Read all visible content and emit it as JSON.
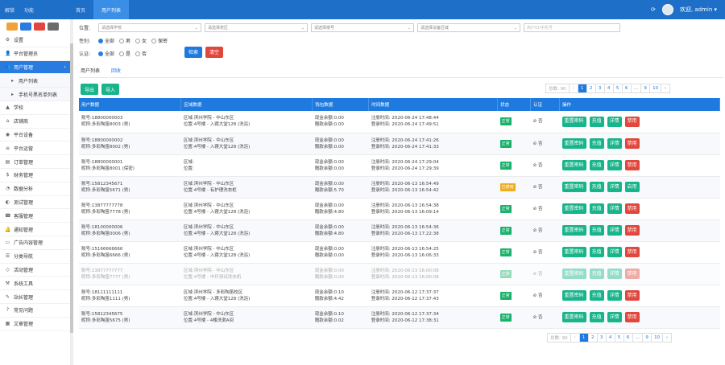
{
  "topbar": {
    "brand": [
      "解锁",
      "功能"
    ],
    "tabs": [
      "首页",
      "用户列表"
    ],
    "active_tab": 1,
    "user": "欢迎, admin ▾",
    "refresh_icon": "refresh-icon",
    "avatar_label": "admin"
  },
  "sidebar": {
    "buttons": [
      "#f0a33a",
      "#2a7be0",
      "#e2473d",
      "#6b6b6b"
    ],
    "items": [
      {
        "label": "设置",
        "icon": "⚙",
        "state": ""
      },
      {
        "label": "平台管理员",
        "icon": "👤",
        "state": ""
      },
      {
        "label": "用户管理",
        "icon": "👥",
        "state": "active"
      },
      {
        "label": "用户列表",
        "icon": "▸",
        "state": "sub"
      },
      {
        "label": "手机号黑名单列表",
        "icon": "▸",
        "state": "sub"
      },
      {
        "label": "学校",
        "icon": "▲",
        "state": ""
      },
      {
        "label": "店铺商",
        "icon": "⌂",
        "state": ""
      },
      {
        "label": "平台设备",
        "icon": "◉",
        "state": ""
      },
      {
        "label": "平台运营",
        "icon": "≡",
        "state": ""
      },
      {
        "label": "订单管理",
        "icon": "▤",
        "state": ""
      },
      {
        "label": "财务管理",
        "icon": "$",
        "state": ""
      },
      {
        "label": "数据分析",
        "icon": "◔",
        "state": ""
      },
      {
        "label": "测试管理",
        "icon": "◐",
        "state": ""
      },
      {
        "label": "客服管理",
        "icon": "☎",
        "state": ""
      },
      {
        "label": "通知管理",
        "icon": "🔔",
        "state": ""
      },
      {
        "label": "广告内容管理",
        "icon": "▭",
        "state": ""
      },
      {
        "label": "分类导航",
        "icon": "☰",
        "state": ""
      },
      {
        "label": "活动管理",
        "icon": "◇",
        "state": ""
      },
      {
        "label": "系统工具",
        "icon": "⚒",
        "state": ""
      },
      {
        "label": "站长管理",
        "icon": "✎",
        "state": ""
      },
      {
        "label": "常见问题",
        "icon": "?",
        "state": ""
      },
      {
        "label": "文章管理",
        "icon": "▦",
        "state": ""
      }
    ]
  },
  "filter": {
    "location_label": "位置:",
    "selects": [
      "请选择学校",
      "请选择校区",
      "请选择楼号",
      "请选择设备区域"
    ],
    "search_placeholder": "用户ID/手机号",
    "gender_label": "性别:",
    "gender_options": [
      "全部",
      "男",
      "女",
      "保密"
    ],
    "gender_selected": 0,
    "verify_label": "认证:",
    "verify_options": [
      "全部",
      "是",
      "否"
    ],
    "verify_selected": 0,
    "search_btn": "检索",
    "reset_btn": "清空"
  },
  "subtabs": [
    "用户列表",
    "回收"
  ],
  "actions": {
    "export": "导出",
    "import": "导入"
  },
  "pager": {
    "total": "总数: 90",
    "first": "‹",
    "pages": [
      "1",
      "2",
      "3",
      "4",
      "5",
      "6",
      "…",
      "9",
      "10",
      "›"
    ],
    "current": "1"
  },
  "table": {
    "headers": [
      "用户数据",
      "区域数据",
      "钱包数据",
      "时间数据",
      "状态",
      "认证",
      "操作"
    ],
    "rows": [
      {
        "user1": "账号:18800000003",
        "user2": "昵称:多彩陶笛8003 (男)",
        "area1": "区域:滨州学院 - 中山东区",
        "area2": "位置:4号楼 - 入寝大堂128 (洗浴)",
        "w1": "现金余额:0.00",
        "w2": "赠款余额:0.00",
        "t1": "注册时间: 2020-06-24 17:48:44",
        "t2": "登录时间: 2020-06-24 17:49:51",
        "status": "正常",
        "st": "g",
        "verify": "否",
        "op": [
          "重置密码",
          "充值",
          "详情",
          "禁用"
        ],
        "op4": "r"
      },
      {
        "user1": "账号:18800000002",
        "user2": "昵称:多彩陶笛8002 (男)",
        "area1": "区域:滨州学院 - 中山东区",
        "area2": "位置:4号楼 - 入寝大堂128 (洗浴)",
        "w1": "现金余额:0.00",
        "w2": "赠款余额:0.00",
        "t1": "注册时间: 2020-06-24 17:41:26",
        "t2": "登录时间: 2020-06-24 17:41:33",
        "status": "正常",
        "st": "g",
        "verify": "否",
        "op": [
          "重置密码",
          "充值",
          "详情",
          "禁用"
        ],
        "op4": "r"
      },
      {
        "user1": "账号:18800000001",
        "user2": "昵称:多彩陶笛8001 (保密)",
        "area1": "区域:",
        "area2": "位置:",
        "w1": "现金余额:0.00",
        "w2": "赠款余额:0.00",
        "t1": "注册时间: 2020-06-24 17:29:04",
        "t2": "登录时间: 2020-06-24 17:29:39",
        "status": "正常",
        "st": "g",
        "verify": "否",
        "op": [
          "重置密码",
          "充值",
          "详情",
          "禁用"
        ],
        "op4": "r"
      },
      {
        "user1": "账号:15812345671",
        "user2": "昵称:多彩陶笛5671 (男)",
        "area1": "区域:滨州学院 - 中山东区",
        "area2": "位置:4号楼 - 有护理洗衣柜",
        "w1": "现金余额:0.00",
        "w2": "赠款余额:5.70",
        "t1": "注册时间: 2020-06-13 16:54:49",
        "t2": "登录时间: 2020-06-13 16:54:42",
        "status": "已禁用",
        "st": "y",
        "verify": "否",
        "op": [
          "重置密码",
          "充值",
          "详情",
          "启用"
        ],
        "op4": "g"
      },
      {
        "user1": "账号:13877777778",
        "user2": "昵称:多彩陶笛7778 (男)",
        "area1": "区域:滨州学院 - 中山东区",
        "area2": "位置:4号楼 - 入寝大堂128 (洗浴)",
        "w1": "现金余额:0.00",
        "w2": "赠款余额:4.80",
        "t1": "注册时间: 2020-06-13 16:54:38",
        "t2": "登录时间: 2020-06-13 16:09:14",
        "status": "正常",
        "st": "g",
        "verify": "否",
        "op": [
          "重置密码",
          "充值",
          "详情",
          "禁用"
        ],
        "op4": "r"
      },
      {
        "user1": "账号:18100000006",
        "user2": "昵称:多彩陶笛0006 (男)",
        "area1": "区域:滨州学院 - 中山东区",
        "area2": "位置:4号楼 - 入寝大堂128 (洗浴)",
        "w1": "现金余额:0.00",
        "w2": "赠款余额:4.80",
        "t1": "注册时间: 2020-06-13 16:54:36",
        "t2": "登录时间: 2020-06-13 17:22:38",
        "status": "正常",
        "st": "g",
        "verify": "否",
        "op": [
          "重置密码",
          "充值",
          "详情",
          "禁用"
        ],
        "op4": "r"
      },
      {
        "user1": "账号:15166666666",
        "user2": "昵称:多彩陶笛6666 (男)",
        "area1": "区域:滨州学院 - 中山东区",
        "area2": "位置:4号楼 - 入寝大堂128 (洗浴)",
        "w1": "现金余额:0.00",
        "w2": "赠款余额:0.00",
        "t1": "注册时间: 2020-06-13 16:54:25",
        "t2": "登录时间: 2020-06-13 16:06:33",
        "status": "正常",
        "st": "g",
        "verify": "否",
        "op": [
          "重置密码",
          "充值",
          "详情",
          "禁用"
        ],
        "op4": "r"
      },
      {
        "user1": "账号:13877777777",
        "user2": "昵称:多彩陶笛7777 (男)",
        "area1": "区域:滨州学院 - 中山东区",
        "area2": "位置:4号楼 - 中环测试洗衣机",
        "w1": "现金余额:0.00",
        "w2": "赠款余额:0.00",
        "t1": "注册时间: 2020-06-13 16:00:08",
        "t2": "登录时间: 2020-06-13 16:00:08",
        "status": "正常",
        "st": "g",
        "verify": "否",
        "op": [
          "重置密码",
          "充值",
          "详情",
          "禁用"
        ],
        "op4": "r",
        "dim": true
      },
      {
        "user1": "账号:18111111111",
        "user2": "昵称:多彩陶笛1111 (男)",
        "area1": "区域:滨州学院 - 多彩陶笛校区",
        "area2": "位置:4号楼 - 入寝大堂128 (洗浴)",
        "w1": "现金余额:0.10",
        "w2": "赠款余额:4.42",
        "t1": "注册时间: 2020-06-12 17:37:37",
        "t2": "登录时间: 2020-06-12 17:37:43",
        "status": "正常",
        "st": "g",
        "verify": "否",
        "op": [
          "重置密码",
          "充值",
          "详情",
          "禁用"
        ],
        "op4": "r"
      },
      {
        "user1": "账号:15812345675",
        "user2": "昵称:多彩陶笛5675 (男)",
        "area1": "区域:滨州学院 - 中山东区",
        "area2": "位置:4号楼 - 4楼洗漱A间",
        "w1": "现金余额:0.10",
        "w2": "赠款余额:0.02",
        "t1": "注册时间: 2020-06-12 17:37:34",
        "t2": "登录时间: 2020-06-12 17:38:31",
        "status": "正常",
        "st": "g",
        "verify": "否",
        "op": [
          "重置密码",
          "充值",
          "详情",
          "禁用"
        ],
        "op4": "r"
      }
    ]
  }
}
